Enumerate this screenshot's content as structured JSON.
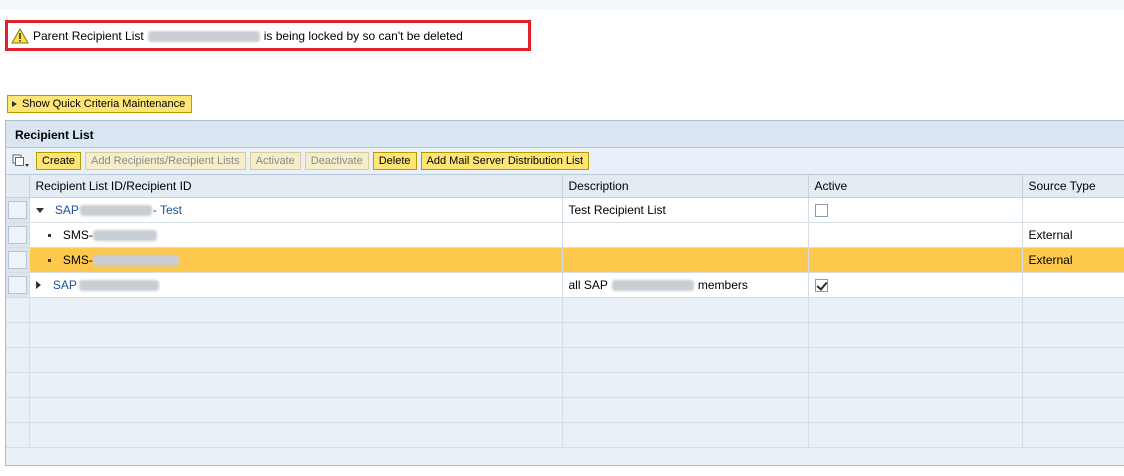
{
  "message": {
    "prefix": "Parent Recipient List",
    "suffix": "is being locked by so can't be deleted",
    "icon": "warning-icon"
  },
  "quick_criteria": {
    "label": "Show Quick Criteria Maintenance"
  },
  "panel": {
    "title": "Recipient List"
  },
  "toolbar": {
    "buttons": [
      {
        "label": "Create",
        "enabled": true
      },
      {
        "label": "Add Recipients/Recipient Lists",
        "enabled": false
      },
      {
        "label": "Activate",
        "enabled": false
      },
      {
        "label": "Deactivate",
        "enabled": false
      },
      {
        "label": "Delete",
        "enabled": true
      },
      {
        "label": "Add Mail Server Distribution List",
        "enabled": true
      }
    ]
  },
  "table": {
    "columns": [
      "Recipient List ID/Recipient ID",
      "Description",
      "Active",
      "Source Type"
    ],
    "rows": [
      {
        "id_prefix": "SAP",
        "id_suffix": "- Test",
        "description": "Test Recipient List",
        "active": false,
        "source_type": "",
        "expanded": true
      },
      {
        "id_prefix": "SMS-",
        "description": "",
        "source_type": "External"
      },
      {
        "id_prefix": "SMS-",
        "description": "",
        "source_type": "External",
        "selected": true
      },
      {
        "id_prefix": "SAP",
        "description_prefix": "all SAP",
        "description_suffix": "members",
        "active": true,
        "source_type": "",
        "expanded": false
      }
    ]
  },
  "colors": {
    "button_yellow": "#ffe575",
    "selected_row": "#ffc94e",
    "highlight_border": "#e0212b",
    "link_blue": "#1a4fa3"
  }
}
